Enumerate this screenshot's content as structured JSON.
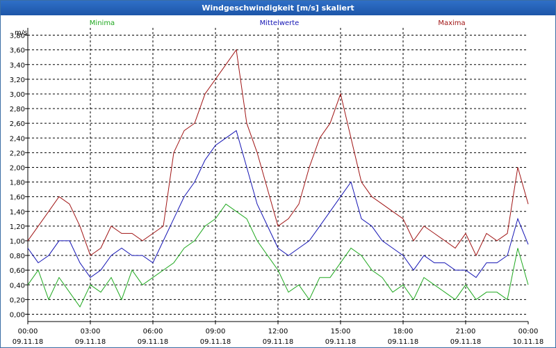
{
  "window": {
    "title": "Windgeschwindigkeit [m/s] skaliert"
  },
  "chart_data": {
    "type": "line",
    "title": "Windgeschwindigkeit [m/s] skaliert",
    "ylabel": "m/s",
    "xlabel": "",
    "ylim": [
      -0.1,
      3.9
    ],
    "xlim": [
      0,
      24
    ],
    "grid": true,
    "legend_placement": "top",
    "y_ticks": [
      "0,00",
      "0,20",
      "0,40",
      "0,60",
      "0,80",
      "1,00",
      "1,20",
      "1,40",
      "1,60",
      "1,80",
      "2,00",
      "2,20",
      "2,40",
      "2,60",
      "2,80",
      "3,00",
      "3,20",
      "3,40",
      "3,60",
      "3,80"
    ],
    "x_ticks": [
      {
        "time": "00:00",
        "date": "09.11.18"
      },
      {
        "time": "03:00",
        "date": "09.11.18"
      },
      {
        "time": "06:00",
        "date": "09.11.18"
      },
      {
        "time": "09:00",
        "date": "09.11.18"
      },
      {
        "time": "12:00",
        "date": "09.11.18"
      },
      {
        "time": "15:00",
        "date": "09.11.18"
      },
      {
        "time": "18:00",
        "date": "09.11.18"
      },
      {
        "time": "21:00",
        "date": "09.11.18"
      },
      {
        "time": "00:00",
        "date": "10.11.18"
      }
    ],
    "series": [
      {
        "name": "Minima",
        "color": "#1fa81f",
        "x": [
          0,
          0.5,
          1,
          1.5,
          2,
          2.5,
          3,
          3.5,
          4,
          4.5,
          5,
          5.5,
          6,
          6.5,
          7,
          7.5,
          8,
          8.5,
          9,
          9.5,
          10,
          10.5,
          11,
          11.5,
          12,
          12.5,
          13,
          13.5,
          14,
          14.5,
          15,
          15.5,
          16,
          16.5,
          17,
          17.5,
          18,
          18.5,
          19,
          19.5,
          20,
          20.5,
          21,
          21.5,
          22,
          22.5,
          23,
          23.5,
          24
        ],
        "values": [
          0.4,
          0.6,
          0.2,
          0.5,
          0.3,
          0.1,
          0.4,
          0.3,
          0.5,
          0.2,
          0.6,
          0.4,
          0.5,
          0.6,
          0.7,
          0.9,
          1.0,
          1.2,
          1.3,
          1.5,
          1.4,
          1.3,
          1.0,
          0.8,
          0.6,
          0.3,
          0.4,
          0.2,
          0.5,
          0.5,
          0.7,
          0.9,
          0.8,
          0.6,
          0.5,
          0.3,
          0.4,
          0.2,
          0.5,
          0.4,
          0.3,
          0.2,
          0.4,
          0.2,
          0.3,
          0.3,
          0.2,
          0.9,
          0.4
        ]
      },
      {
        "name": "Mittelwerte",
        "color": "#1414b4",
        "x": [
          0,
          0.5,
          1,
          1.5,
          2,
          2.5,
          3,
          3.5,
          4,
          4.5,
          5,
          5.5,
          6,
          6.5,
          7,
          7.5,
          8,
          8.5,
          9,
          9.5,
          10,
          10.5,
          11,
          11.5,
          12,
          12.5,
          13,
          13.5,
          14,
          14.5,
          15,
          15.5,
          16,
          16.5,
          17,
          17.5,
          18,
          18.5,
          19,
          19.5,
          20,
          20.5,
          21,
          21.5,
          22,
          22.5,
          23,
          23.5,
          24
        ],
        "values": [
          0.9,
          0.7,
          0.8,
          1.0,
          1.0,
          0.7,
          0.5,
          0.6,
          0.8,
          0.9,
          0.8,
          0.8,
          0.7,
          1.0,
          1.3,
          1.6,
          1.8,
          2.1,
          2.3,
          2.4,
          2.5,
          2.0,
          1.5,
          1.2,
          0.9,
          0.8,
          0.9,
          1.0,
          1.2,
          1.4,
          1.6,
          1.8,
          1.3,
          1.2,
          1.0,
          0.9,
          0.8,
          0.6,
          0.8,
          0.7,
          0.7,
          0.6,
          0.6,
          0.5,
          0.7,
          0.7,
          0.8,
          1.3,
          0.95
        ]
      },
      {
        "name": "Maxima",
        "color": "#a01414",
        "x": [
          0,
          0.5,
          1,
          1.5,
          2,
          2.5,
          3,
          3.5,
          4,
          4.5,
          5,
          5.5,
          6,
          6.5,
          7,
          7.5,
          8,
          8.5,
          9,
          9.5,
          10,
          10.5,
          11,
          11.5,
          12,
          12.5,
          13,
          13.5,
          14,
          14.5,
          15,
          15.5,
          16,
          16.5,
          17,
          17.5,
          18,
          18.5,
          19,
          19.5,
          20,
          20.5,
          21,
          21.5,
          22,
          22.5,
          23,
          23.5,
          24
        ],
        "values": [
          1.0,
          1.2,
          1.4,
          1.6,
          1.5,
          1.2,
          0.8,
          0.9,
          1.2,
          1.1,
          1.1,
          1.0,
          1.1,
          1.2,
          2.2,
          2.5,
          2.6,
          3.0,
          3.2,
          3.4,
          3.6,
          2.6,
          2.2,
          1.7,
          1.2,
          1.3,
          1.5,
          2.0,
          2.4,
          2.6,
          3.0,
          2.4,
          1.8,
          1.6,
          1.5,
          1.4,
          1.3,
          1.0,
          1.2,
          1.1,
          1.0,
          0.9,
          1.1,
          0.8,
          1.1,
          1.0,
          1.1,
          2.0,
          1.5
        ]
      }
    ]
  }
}
